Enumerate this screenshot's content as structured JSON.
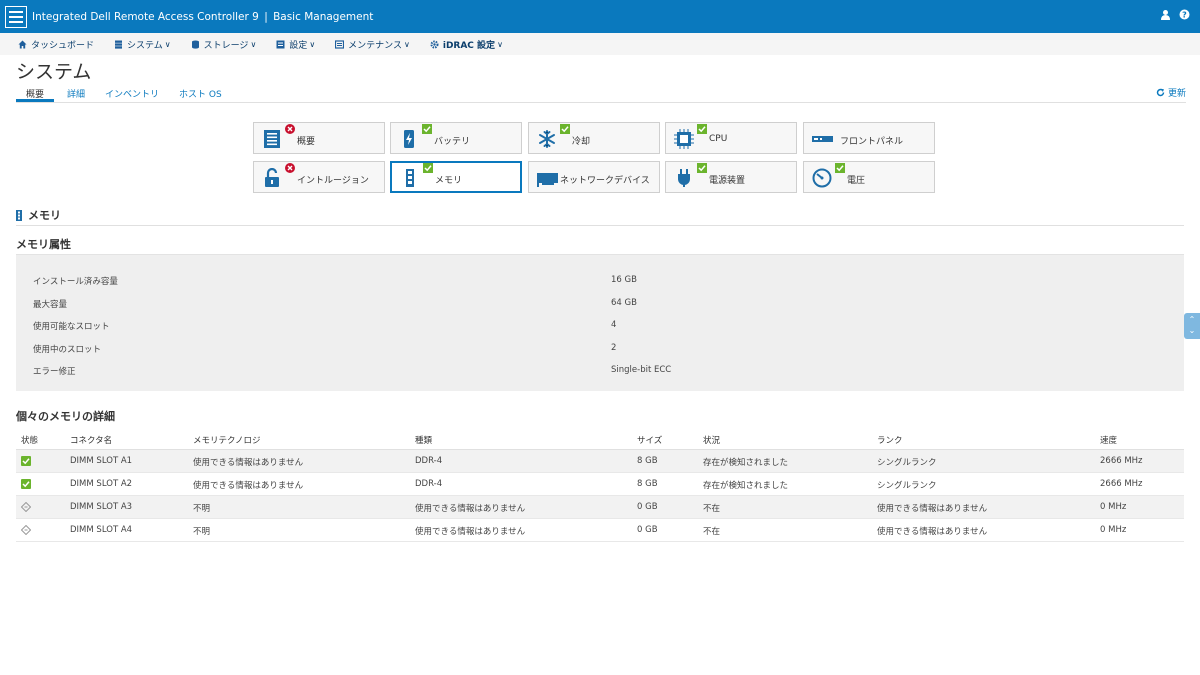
{
  "header": {
    "app_title": "Integrated Dell Remote Access Controller 9",
    "edition": "Basic Management",
    "separator": "|",
    "user_icon": "user-icon",
    "help_icon": "help-icon"
  },
  "nav": {
    "items": [
      {
        "label": "タッシュボード",
        "icon": "home-icon",
        "dropdown": false
      },
      {
        "label": "システム",
        "icon": "server-icon",
        "dropdown": true
      },
      {
        "label": "ストレージ",
        "icon": "database-icon",
        "dropdown": true
      },
      {
        "label": "設定",
        "icon": "settings-icon",
        "dropdown": true
      },
      {
        "label": "メンテナンス",
        "icon": "maintenance-icon",
        "dropdown": true
      },
      {
        "label": "iDRAC 設定",
        "icon": "gear-icon",
        "dropdown": true
      }
    ],
    "chevron": "∨"
  },
  "page": {
    "title": "システム",
    "tabs": [
      "概要",
      "詳細",
      "インベントリ",
      "ホスト OS"
    ],
    "refresh": "更新"
  },
  "components": [
    {
      "label": "概要",
      "status": "critical",
      "icon": "summary-icon"
    },
    {
      "label": "バッテリ",
      "status": "ok",
      "icon": "battery-icon"
    },
    {
      "label": "冷却",
      "status": "ok",
      "icon": "cooling-icon"
    },
    {
      "label": "CPU",
      "status": "ok",
      "icon": "cpu-icon"
    },
    {
      "label": "フロントパネル",
      "status": "none",
      "icon": "front-panel-icon"
    },
    {
      "label": "イントルージョン",
      "status": "critical",
      "icon": "intrusion-icon"
    },
    {
      "label": "メモリ",
      "status": "ok",
      "icon": "memory-icon",
      "selected": true
    },
    {
      "label": "ネットワークデバイス",
      "status": "none",
      "icon": "network-device-icon"
    },
    {
      "label": "電源装置",
      "status": "ok",
      "icon": "power-supply-icon"
    },
    {
      "label": "電圧",
      "status": "ok",
      "icon": "voltage-icon"
    }
  ],
  "memory": {
    "heading": "メモリ",
    "attributes_heading": "メモリ属性",
    "attributes": [
      {
        "key": "インストール済み容量",
        "value": "16 GB"
      },
      {
        "key": "最大容量",
        "value": "64 GB"
      },
      {
        "key": "使用可能なスロット",
        "value": "4"
      },
      {
        "key": "使用中のスロット",
        "value": "2"
      },
      {
        "key": "エラー修正",
        "value": "Single-bit ECC"
      }
    ],
    "details_heading": "個々のメモリの詳細",
    "columns": [
      "状態",
      "コネクタ名",
      "メモリテクノロジ",
      "種類",
      "サイズ",
      "状況",
      "ランク",
      "速度"
    ],
    "rows": [
      {
        "status": "ok",
        "cells": [
          "DIMM SLOT A1",
          "使用できる情報はありません",
          "DDR-4",
          "8 GB",
          "存在が検知されました",
          "シングルランク",
          "2666 MHz"
        ]
      },
      {
        "status": "ok",
        "cells": [
          "DIMM SLOT A2",
          "使用できる情報はありません",
          "DDR-4",
          "8 GB",
          "存在が検知されました",
          "シングルランク",
          "2666 MHz"
        ]
      },
      {
        "status": "unknown",
        "cells": [
          "DIMM SLOT A3",
          "不明",
          "使用できる情報はありません",
          "0 GB",
          "不在",
          "使用できる情報はありません",
          "0 MHz"
        ]
      },
      {
        "status": "unknown",
        "cells": [
          "DIMM SLOT A4",
          "不明",
          "使用できる情報はありません",
          "0 GB",
          "不在",
          "使用できる情報はありません",
          "0 MHz"
        ]
      }
    ]
  },
  "colors": {
    "brand": "#0a79be",
    "ok": "#6bb42d",
    "critical": "#c8102e"
  }
}
